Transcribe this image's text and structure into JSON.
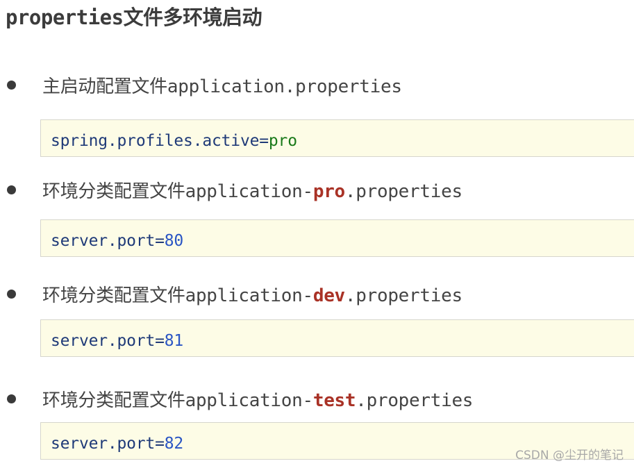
{
  "title": "properties文件多环境启动",
  "items": [
    {
      "label_prefix": "主启动配置文件application",
      "label_highlight": "",
      "label_suffix": ".properties",
      "code_key": "spring.profiles.active",
      "code_eq": "=",
      "code_value": "pro"
    },
    {
      "label_prefix": "环境分类配置文件application-",
      "label_highlight": "pro",
      "label_suffix": ".properties",
      "code_key": "server.port",
      "code_eq": "=",
      "code_value": "80"
    },
    {
      "label_prefix": "环境分类配置文件application-",
      "label_highlight": "dev",
      "label_suffix": ".properties",
      "code_key": "server.port",
      "code_eq": "=",
      "code_value": "81"
    },
    {
      "label_prefix": "环境分类配置文件application-",
      "label_highlight": "test",
      "label_suffix": ".properties",
      "code_key": "server.port",
      "code_eq": "=",
      "code_value": "82"
    }
  ],
  "watermark": "CSDN @尘开的笔记",
  "colors": {
    "highlight": "#a93226",
    "code_key": "#1f3a78",
    "code_string_value": "#1a7a1a",
    "code_number_value": "#2a55c4",
    "code_background": "#fdfce6"
  }
}
